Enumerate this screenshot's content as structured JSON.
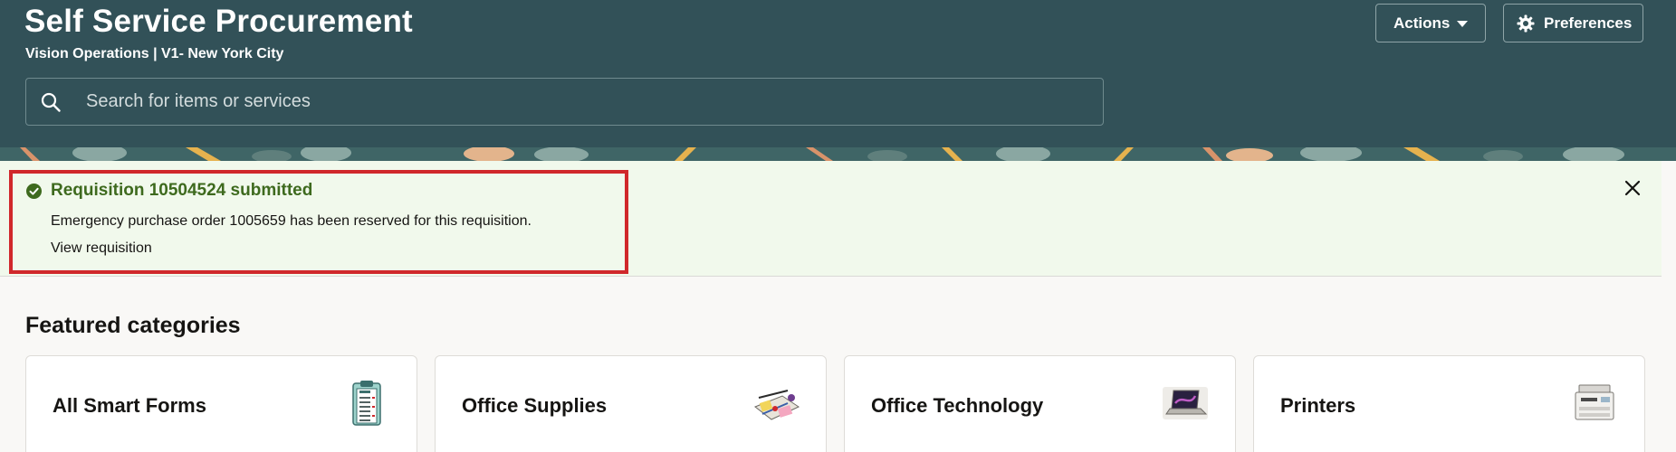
{
  "header": {
    "title": "Self Service Procurement",
    "subtitle": "Vision Operations | V1- New York City",
    "actions_label": "Actions",
    "preferences_label": "Preferences"
  },
  "search": {
    "placeholder": "Search for items or services",
    "value": ""
  },
  "message": {
    "title": "Requisition 10504524 submitted",
    "body": "Emergency purchase order 1005659 has been reserved for this requisition.",
    "link": "View requisition",
    "status": "success",
    "status_color": "#3e6a1e"
  },
  "featured": {
    "title": "Featured categories",
    "cards": [
      {
        "label": "All Smart Forms",
        "icon": "clipboard-forms-icon"
      },
      {
        "label": "Office Supplies",
        "icon": "office-supplies-icon"
      },
      {
        "label": "Office Technology",
        "icon": "laptop-icon"
      },
      {
        "label": "Printers",
        "icon": "printer-icon"
      }
    ]
  },
  "colors": {
    "header_bg": "#325158",
    "message_bg": "#f1f9ec",
    "highlight_border": "#d0282b"
  }
}
